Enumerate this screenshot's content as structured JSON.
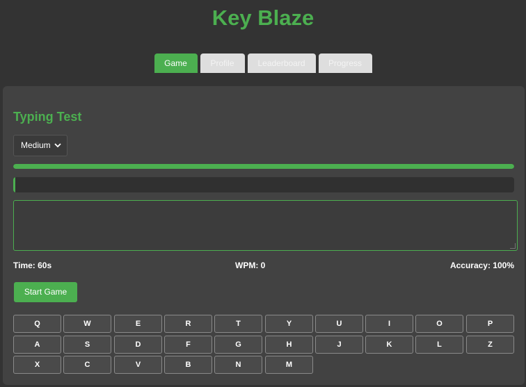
{
  "app": {
    "title": "Key Blaze"
  },
  "tabs": [
    {
      "label": "Game",
      "active": true
    },
    {
      "label": "Profile",
      "active": false
    },
    {
      "label": "Leaderboard",
      "active": false
    },
    {
      "label": "Progress",
      "active": false
    }
  ],
  "game": {
    "section_title": "Typing Test",
    "difficulty": {
      "selected": "Medium"
    },
    "timer_fraction": 1.0,
    "text_progress_fraction": 0.004,
    "input_value": "",
    "stats": {
      "time": "Time: 60s",
      "wpm": "WPM: 0",
      "accuracy": "Accuracy: 100%"
    },
    "start_button": "Start Game"
  },
  "keyboard": {
    "rows": [
      [
        "Q",
        "W",
        "E",
        "R",
        "T",
        "Y",
        "U",
        "I",
        "O",
        "P"
      ],
      [
        "A",
        "S",
        "D",
        "F",
        "G",
        "H",
        "J",
        "K",
        "L",
        "Z"
      ],
      [
        "X",
        "C",
        "V",
        "B",
        "N",
        "M"
      ]
    ]
  },
  "colors": {
    "accent": "#4caf50",
    "background": "#333333",
    "panel": "#424242",
    "tab_inactive": "#dedede"
  }
}
